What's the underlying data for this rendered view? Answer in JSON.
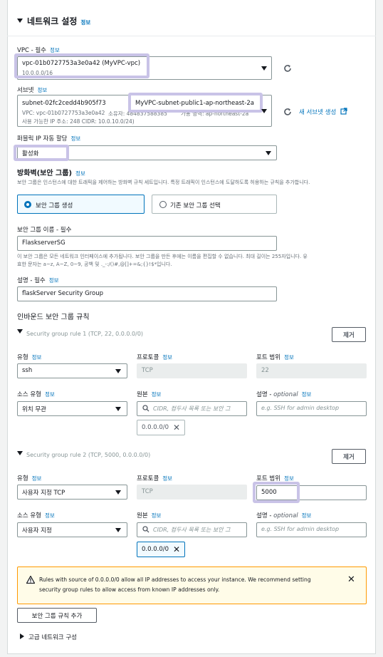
{
  "section": {
    "title": "네트워크 설정",
    "info": "정보"
  },
  "vpc": {
    "label": "VPC - 필수",
    "info": "정보",
    "value": "vpc-01b0727753a3e0a42 (MyVPC-vpc)",
    "cidr": "10.0.0.0/16"
  },
  "subnet": {
    "label": "서브넷",
    "info": "정보",
    "value": "subnet-02fc2cedd4b905f73",
    "name": "MyVPC-subnet-public1-ap-northeast-2a",
    "detail1": "VPC: vpc-01b0727753a3e0a42",
    "detail1_owner": "소유자: 484837588385",
    "detail1_zone": "가용 영역: ap-northeast-2a",
    "detail2": "사용 가능한 IP 주소: 248    CIDR: 10.0.10.0/24)",
    "create_link": "새 서브넷 생성"
  },
  "public_ip": {
    "label": "퍼블릭 IP 자동 할당",
    "info": "정보",
    "value": "활성화"
  },
  "firewall": {
    "title": "방화벽(보안 그룹)",
    "info": "정보",
    "description": "보안 그룹은 인스턴스에 대한 트래픽을 제어하는 방화벽 규칙 세트입니다. 특정 트래픽이 인스턴스에 도달하도록 허용하는 규칙을 추가합니다.",
    "option_create": "보안 그룹 생성",
    "option_select": "기존 보안 그룹 선택"
  },
  "sg_name": {
    "label": "보안 그룹 이름 - 필수",
    "value": "FlaskserverSG",
    "help1": "이 보안 그룹은 모든 네트워크 인터페이스에 추가됩니다. 보안 그룹을 만든 후에는 이름을 편집할 수 없습니다. 최대 길이는 255자입니다. 유",
    "help2": "효한 문자는 a~z, A~Z, 0~9, 공백 및 ._-:/()#,@[]+=&;{}!$*입니다."
  },
  "sg_desc": {
    "label": "설명 - 필수",
    "info": "정보",
    "value": "flaskServer Security Group"
  },
  "inbound": {
    "title": "인바운드 보안 그룹 규칙",
    "remove_label": "제거",
    "type_label": "유형",
    "protocol_label": "프로토콜",
    "port_label": "포트 범위",
    "source_type_label": "소스 유형",
    "source_label": "원본",
    "desc_label": "설명",
    "desc_optional": "optional",
    "info": "정보",
    "source_placeholder": "CIDR, 접두사 목록 또는 보안 그",
    "desc_placeholder": "e.g. SSH for admin desktop",
    "rules": [
      {
        "header": "Security group rule 1 (TCP, 22, 0.0.0.0/0)",
        "type": "ssh",
        "protocol": "TCP",
        "port": "22",
        "source_type": "위치 무관",
        "source_token": "0.0.0.0/0"
      },
      {
        "header": "Security group rule 2 (TCP, 5000, 0.0.0.0/0)",
        "type": "사용자 지정 TCP",
        "protocol": "TCP",
        "port": "5000",
        "source_type": "사용자 지정",
        "source_token": "0.0.0.0/0"
      }
    ]
  },
  "warning": {
    "line1": "Rules with source of 0.0.0.0/0 allow all IP addresses to access your instance. We recommend setting",
    "line2": "security group rules to allow access from known IP addresses only."
  },
  "add_rule_label": "보안 그룹 규칙 추가",
  "advanced_label": "고급 네트워크 구성",
  "colors": {
    "accent": "#0073bb",
    "highlight": "#c9c3e7",
    "warning_border": "#ff9900"
  }
}
